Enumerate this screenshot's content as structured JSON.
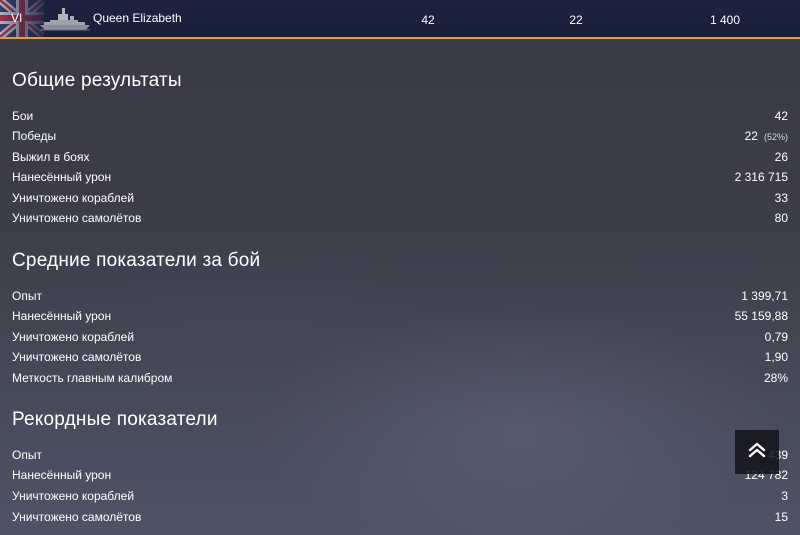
{
  "ship": {
    "tier": "VI",
    "name": "Queen Elizabeth",
    "battles": "42",
    "wins": "22",
    "value": "1 400"
  },
  "sections": {
    "general": {
      "title": "Общие результаты",
      "rows": [
        {
          "label": "Бои",
          "value": "42"
        },
        {
          "label": "Победы",
          "value": "22",
          "sub": "(52%)"
        },
        {
          "label": "Выжил в боях",
          "value": "26"
        },
        {
          "label": "Нанесённый урон",
          "value": "2 316 715"
        },
        {
          "label": "Уничтожено кораблей",
          "value": "33"
        },
        {
          "label": "Уничтожено самолётов",
          "value": "80"
        }
      ]
    },
    "average": {
      "title": "Средние показатели за бой",
      "rows": [
        {
          "label": "Опыт",
          "value": "1 399,71"
        },
        {
          "label": "Нанесённый урон",
          "value": "55 159,88"
        },
        {
          "label": "Уничтожено кораблей",
          "value": "0,79"
        },
        {
          "label": "Уничтожено самолётов",
          "value": "1,90"
        },
        {
          "label": "Меткость главным калибром",
          "value": "28%"
        }
      ]
    },
    "records": {
      "title": "Рекордные показатели",
      "rows": [
        {
          "label": "Опыт",
          "value": "439"
        },
        {
          "label": "Нанесённый урон",
          "value": "124 782"
        },
        {
          "label": "Уничтожено кораблей",
          "value": "3"
        },
        {
          "label": "Уничтожено самолётов",
          "value": "15"
        }
      ]
    }
  },
  "icons": {
    "flag": "uk-flag-icon",
    "ship": "battleship-icon",
    "scroll": "double-chevron-up-icon"
  },
  "colors": {
    "accent": "#e0a32a",
    "header_bg": "#1c2240"
  }
}
